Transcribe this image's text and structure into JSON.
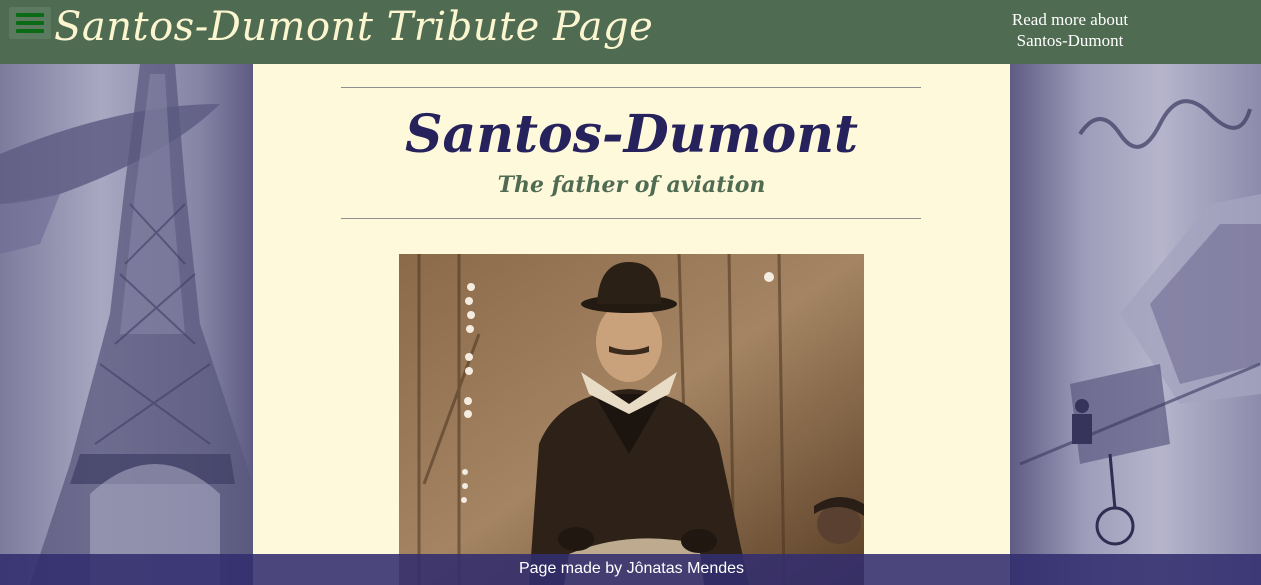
{
  "header": {
    "menu_icon": "hamburger-menu-icon",
    "title": "Santos-Dumont Tribute Page",
    "read_more_line1": "Read more about",
    "read_more_line2": "Santos-Dumont"
  },
  "main": {
    "title": "Santos-Dumont",
    "subtitle": "The father of aviation",
    "image_alt": "Portrait of Santos-Dumont"
  },
  "footer": {
    "text": "Page made by Jônatas Mendes"
  },
  "colors": {
    "header_bg": "#4f6b52",
    "title_text": "#fbf6cf",
    "content_bg": "#fff9dc",
    "main_title": "#26225c",
    "subtitle": "#4f6b52",
    "footer_bg": "#322d6e"
  }
}
